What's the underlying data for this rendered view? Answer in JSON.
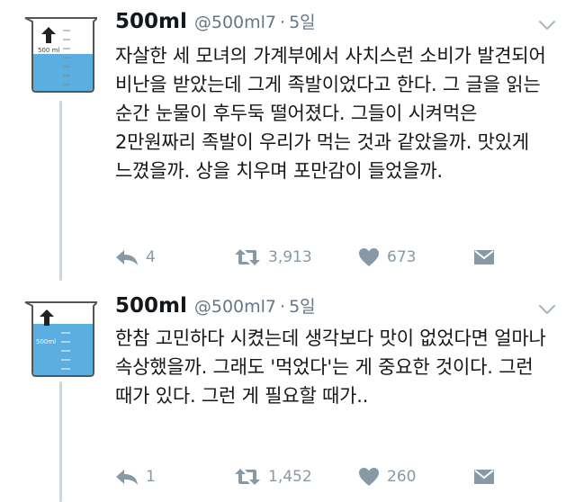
{
  "tweets": [
    {
      "display_name": "500ml",
      "handle": "@500ml7",
      "separator": "·",
      "time": "5일",
      "text": "자살한 세 모녀의 가계부에서 사치스런 소비가 발견되어 비난을 받았는데 그게 족발이었다고 한다. 그 글을 읽는 순간 눈물이 후두둑 떨어졌다. 그들이 시켜먹은 2만원짜리 족발이 우리가 먹는 것과 같았을까. 맛있게 느꼈을까. 상을 치우며 포만감이 들었을까.",
      "reply_count": "4",
      "retweet_count": "3,913",
      "like_count": "673",
      "avatar_label": "500 ml"
    },
    {
      "display_name": "500ml",
      "handle": "@500ml7",
      "separator": "·",
      "time": "5일",
      "text": "한참 고민하다 시켰는데 생각보다 맛이 없었다면 얼마나 속상했을까. 그래도 '먹었다'는 게 중요한 것이다. 그런 때가 있다. 그런 게 필요할 때가..",
      "reply_count": "1",
      "retweet_count": "1,452",
      "like_count": "260",
      "avatar_label": "500ml"
    }
  ],
  "icons": {
    "reply": "reply-icon",
    "retweet": "retweet-icon",
    "like": "heart-icon",
    "dm": "envelope-icon",
    "more": "chevron-down-icon"
  },
  "colors": {
    "text": "#14171a",
    "muted": "#657786",
    "action": "#8899a6",
    "thread": "#ccd6dd",
    "water": "#5aaee0"
  }
}
